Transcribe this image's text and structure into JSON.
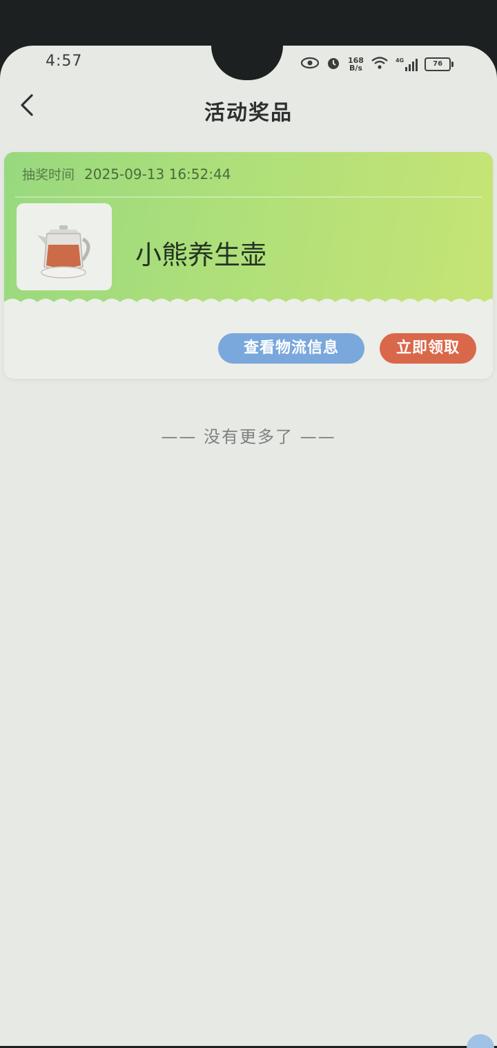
{
  "status_bar": {
    "time": "4:57",
    "net_speed_value": "168",
    "net_speed_unit": "B/s",
    "network_type": "4G",
    "battery": "76",
    "icons": [
      "eye-icon",
      "alarm-icon",
      "wifi-icon",
      "signal-icon",
      "battery-icon"
    ]
  },
  "header": {
    "title": "活动奖品",
    "back_icon": "chevron-left-icon"
  },
  "prize_card": {
    "draw_time_label": "抽奖时间",
    "draw_time_value": "2025-09-13 16:52:44",
    "prize_name": "小熊养生壶",
    "image_icon": "kettle-icon",
    "view_logistics_label": "查看物流信息",
    "claim_label": "立即领取",
    "colors": {
      "card_gradient_start": "#98d97e",
      "card_gradient_end": "#c6e475",
      "logistics_button": "#7aa7dc",
      "claim_button": "#d9684a"
    }
  },
  "list_footer": {
    "text": "—— 没有更多了 ——"
  }
}
